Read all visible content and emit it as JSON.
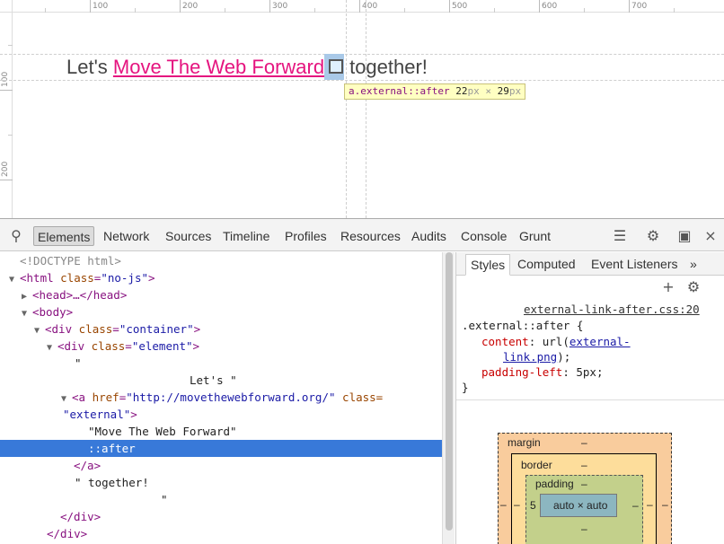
{
  "viewport": {
    "ruler_top_labels": [
      "100",
      "200",
      "300",
      "400",
      "500",
      "600",
      "700"
    ],
    "ruler_left_labels": [
      "100",
      "200"
    ],
    "demo": {
      "prefix": "Let's ",
      "link_text": "Move The Web Forward",
      "suffix": "together!"
    },
    "tooltip": {
      "selector": "a.external::after",
      "width": "22",
      "unit": "px",
      "times": " × ",
      "height": "29"
    }
  },
  "toolbar": {
    "tabs": [
      "Elements",
      "Network",
      "Sources",
      "Timeline",
      "Profiles",
      "Resources",
      "Audits",
      "Console",
      "Grunt"
    ],
    "active_tab": "Elements"
  },
  "dom": {
    "doctype": "<!DOCTYPE html>",
    "html_open": "<html ",
    "html_attr": "class",
    "html_val": "\"no-js\"",
    "html_close": ">",
    "head": "<head>…</head>",
    "body_open": "<body>",
    "div_container_open": "<div ",
    "div_container_attr": "class",
    "div_container_val": "\"container\"",
    "div_element_attr": "class",
    "div_element_val": "\"element\"",
    "quote_open": "\"",
    "text_lets": "Let's \"",
    "a_open": "<a ",
    "a_href_attr": "href",
    "a_href_val": "\"http://movethewebforward.org/\"",
    "a_class_attr": "class=",
    "a_class_val": "\"external\"",
    "text_link": "\"Move The Web Forward\"",
    "pseudo_after": "::after",
    "a_close": "</a>",
    "text_together": "\" together!",
    "quote_close": "\"",
    "div_close_1": "</div>",
    "div_close_2": "</div>",
    "gt": ">",
    "eq": "="
  },
  "styles": {
    "tabs": [
      "Styles",
      "Computed",
      "Event Listeners"
    ],
    "more": "»",
    "source": "external-link-after.css:20",
    "selector": ".external::after {",
    "content_prop": "content",
    "content_val_pre": ": url(",
    "content_link_1": "external-",
    "content_link_2": "link.png",
    "content_val_post": ");",
    "padding_prop": "padding-left",
    "padding_val": ": 5px;",
    "close_brace": "}"
  },
  "boxmodel": {
    "margin_label": "margin",
    "margin_top": "–",
    "margin_left": "–",
    "margin_right": "–",
    "border_label": "border",
    "border_top": "–",
    "border_left": "–",
    "border_right": "–",
    "padding_label": "padding",
    "padding_top": "–",
    "padding_left": "5",
    "padding_right": "–",
    "padding_bottom": "–",
    "content": "auto × auto"
  }
}
